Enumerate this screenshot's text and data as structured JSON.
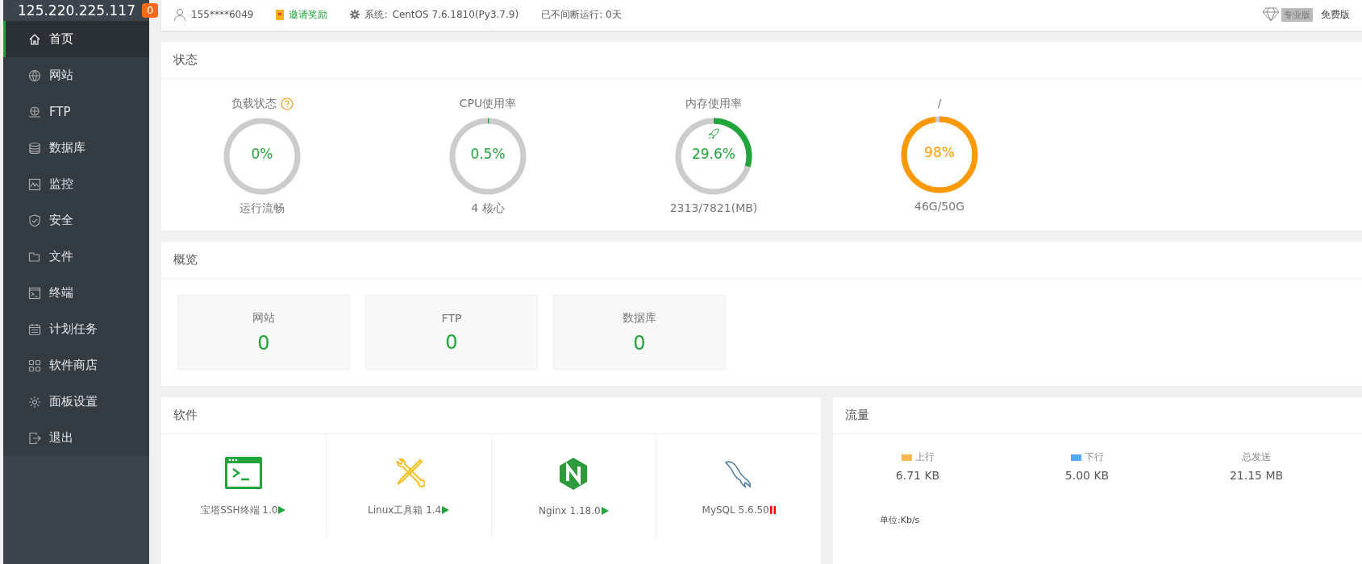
{
  "sidebar": {
    "host": "125.220.225.117",
    "badge": "0",
    "items": [
      {
        "label": "首页",
        "selected": true
      },
      {
        "label": "网站",
        "selected": false
      },
      {
        "label": "FTP",
        "selected": false
      },
      {
        "label": "数据库",
        "selected": false
      },
      {
        "label": "监控",
        "selected": false
      },
      {
        "label": "安全",
        "selected": false
      },
      {
        "label": "文件",
        "selected": false
      },
      {
        "label": "终端",
        "selected": false
      },
      {
        "label": "计划任务",
        "selected": false
      },
      {
        "label": "软件商店",
        "selected": false
      },
      {
        "label": "面板设置",
        "selected": false
      },
      {
        "label": "退出",
        "selected": false
      }
    ]
  },
  "topbar": {
    "user": "155****6049",
    "invite": "邀请奖励",
    "system_label": "系统:",
    "system": "CentOS 7.6.1810(Py3.7.9)",
    "uptime": "已不间断运行: 0天",
    "pro": "专业版",
    "edition": "免费版"
  },
  "status": {
    "title": "状态",
    "gauges": [
      {
        "label": "负载状态",
        "help": true,
        "value": "0%",
        "level": 0,
        "caption": "运行流畅",
        "color": "#20a53a",
        "rocket": false
      },
      {
        "label": "CPU使用率",
        "help": false,
        "value": "0.5%",
        "level": 0.005,
        "caption": "4 核心",
        "color": "#20a53a",
        "rocket": false
      },
      {
        "label": "内存使用率",
        "help": false,
        "value": "29.6%",
        "level": 0.296,
        "caption": "2313/7821(MB)",
        "color": "#20a53a",
        "rocket": true
      },
      {
        "label": "/",
        "help": false,
        "value": "98%",
        "level": 0.98,
        "caption": "46G/50G",
        "color": "#ff9900",
        "rocket": false
      }
    ]
  },
  "overview": {
    "title": "概览",
    "cards": [
      {
        "label": "网站",
        "value": "0"
      },
      {
        "label": "FTP",
        "value": "0"
      },
      {
        "label": "数据库",
        "value": "0"
      }
    ]
  },
  "software": {
    "title": "软件",
    "items": [
      {
        "name": "宝塔SSH终端 1.0",
        "kind": "terminal",
        "running": true
      },
      {
        "name": "Linux工具箱 1.4",
        "kind": "tools",
        "running": true
      },
      {
        "name": "Nginx 1.18.0",
        "kind": "nginx",
        "running": true
      },
      {
        "name": "MySQL 5.6.50",
        "kind": "mysql",
        "running": false
      }
    ]
  },
  "traffic": {
    "title": "流量",
    "stats": [
      {
        "label": "上行",
        "value": "6.71 KB",
        "color": "#f7b851"
      },
      {
        "label": "下行",
        "value": "5.00 KB",
        "color": "#52a9ff"
      },
      {
        "label": "总发送",
        "value": "21.15 MB"
      }
    ],
    "unit": "单位:Kb/s"
  }
}
